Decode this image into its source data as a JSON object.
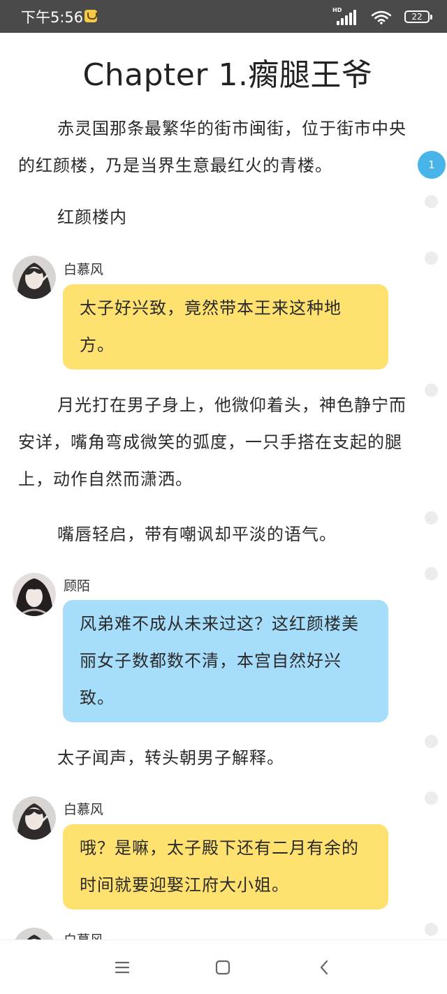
{
  "status_bar": {
    "time": "下午5:56",
    "network": "HD",
    "battery": "22",
    "icons": [
      "app-notification-icon",
      "signal-icon",
      "wifi-icon",
      "battery-icon"
    ]
  },
  "chapter": {
    "title": "Chapter 1.瘸腿王爷"
  },
  "story": {
    "para1": "赤灵国那条最繁华的街市闽街，位于街市中央的红颜楼，乃是当界生意最红火的青楼。",
    "para2": "红颜楼内",
    "msg1": {
      "speaker": "白慕风",
      "text": "太子好兴致，竟然带本王来这种地方。",
      "color": "#fee16f"
    },
    "para3": "月光打在男子身上，他微仰着头，神色静宁而安详，嘴角弯成微笑的弧度，一只手搭在支起的腿上，动作自然而潇洒。",
    "para4": "嘴唇轻启，带有嘲讽却平淡的语气。",
    "msg2": {
      "speaker": "顾陌",
      "text": "风弟难不成从未来过这？这红颜楼美丽女子数都数不清，本宫自然好兴致。",
      "color": "#a6ddfb"
    },
    "para5": "太子闻声，转头朝男子解释。",
    "msg3": {
      "speaker": "白慕风",
      "text": "哦？是嘛，太子殿下还有二月有余的时间就要迎娶江府大小姐。",
      "color": "#fee16f"
    },
    "msg4": {
      "speaker": "白慕风"
    }
  },
  "rail": {
    "active_label": "1"
  },
  "nav": {
    "buttons": [
      "menu-icon",
      "home-icon",
      "back-icon"
    ]
  }
}
